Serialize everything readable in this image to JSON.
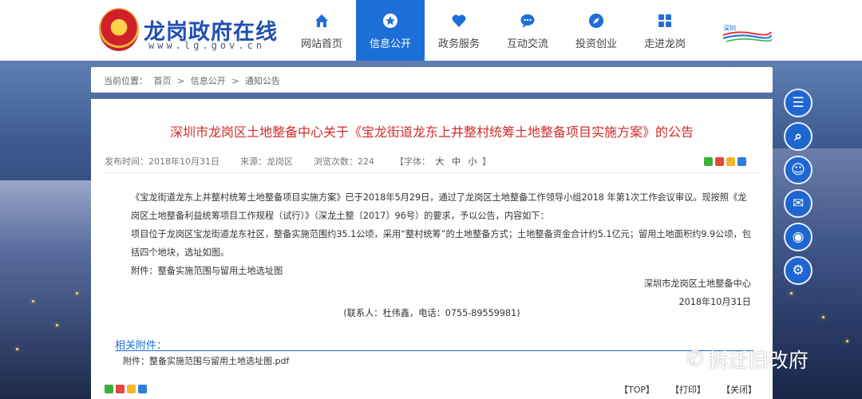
{
  "header": {
    "site_title": "龙岗政府在线",
    "site_url": "www.lg.gov.cn",
    "emblem_icon": "national-emblem-icon",
    "brand_text": "深圳"
  },
  "nav": [
    {
      "label": "网站首页",
      "icon": "home-icon",
      "active": false
    },
    {
      "label": "信息公开",
      "icon": "star-badge-icon",
      "active": true
    },
    {
      "label": "政务服务",
      "icon": "heart-icon",
      "active": false
    },
    {
      "label": "互动交流",
      "icon": "chat-bubble-icon",
      "active": false
    },
    {
      "label": "投资创业",
      "icon": "compass-icon",
      "active": false
    },
    {
      "label": "走进龙岗",
      "icon": "map-grid-icon",
      "active": false
    }
  ],
  "breadcrumb": {
    "prefix": "当前位置：",
    "items": [
      "首页",
      ">",
      "信息公开",
      ">",
      "通知公告"
    ]
  },
  "article": {
    "title": "深圳市龙岗区土地整备中心关于《宝龙街道龙东上井整村统筹土地整备项目实施方案》的公告",
    "publish_label": "发布时间：",
    "publish_date": "2018年10月31日",
    "source_label": "来源：",
    "source": "龙岗区",
    "views_label": "浏览次数：",
    "views": "224",
    "font_label": "【字体：",
    "font_large": "大",
    "font_medium": "中",
    "font_small": "小",
    "font_close": "】",
    "para1": "《宝龙街道龙东上井整村统筹土地整备项目实施方案》已于2018年5月29日，通过了龙岗区土地整备工作领导小组2018 年第1次工作会议审议。现按照《龙岗区土地整备利益统筹项目工作规程（试行）》（深龙土整〔2017〕96号）的要求，予以公告，内容如下：",
    "para2": "项目位于龙岗区宝龙街道龙东社区，整备实施范围约35.1公顷，采用“整村统筹”的土地整备方式；土地整备资金合计约5.1亿元；留用土地面积约9.9公顷，包括四个地块，选址如图。",
    "para3": "附件：整备实施范围与留用土地选址图",
    "sign_org": "深圳市龙岗区土地整备中心",
    "sign_date": "2018年10月31日",
    "contact": "(联系人：杜伟鑫，电话：0755-89559981)",
    "attachments_title": "相关附件：",
    "attachment_file": "附件：整备实施范围与留用土地选址图.pdf"
  },
  "footer_links": [
    "【TOP】",
    "【打印】",
    "【关闭】"
  ],
  "side_buttons": [
    {
      "icon": "chart-board-icon",
      "glyph": "☰"
    },
    {
      "icon": "search-text-icon",
      "glyph": "⌕"
    },
    {
      "icon": "customer-service-icon",
      "glyph": "☺"
    },
    {
      "icon": "wechat-icon",
      "glyph": "✉"
    },
    {
      "icon": "weibo-icon",
      "glyph": "◉"
    },
    {
      "icon": "settings-gear-icon",
      "glyph": "⚙"
    }
  ],
  "watermark": {
    "icon": "wechat-logo-icon",
    "text": "拆迁旧改府"
  },
  "colors": {
    "brand_blue": "#1d6fd8",
    "title_red": "#d32b2b",
    "site_title_blue": "#1f4fb1"
  }
}
